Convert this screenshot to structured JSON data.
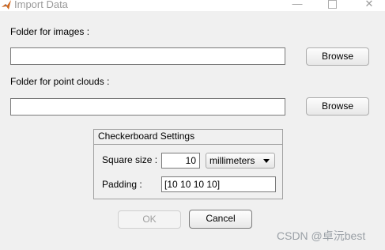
{
  "window": {
    "title": "Import Data",
    "min_glyph": "—",
    "close_glyph": "✕"
  },
  "images": {
    "label": "Folder for images :",
    "value": "",
    "browse_label": "Browse"
  },
  "point_clouds": {
    "label": "Folder for point clouds :",
    "value": "",
    "browse_label": "Browse"
  },
  "checkerboard": {
    "title": "Checkerboard Settings",
    "square_size_label": "Square size :",
    "square_size_value": "10",
    "units_selected": "millimeters",
    "padding_label": "Padding :",
    "padding_value": "[10 10 10 10]"
  },
  "actions": {
    "ok_label": "OK",
    "cancel_label": "Cancel",
    "ok_enabled": false
  },
  "watermark": "CSDN @卓沅best"
}
